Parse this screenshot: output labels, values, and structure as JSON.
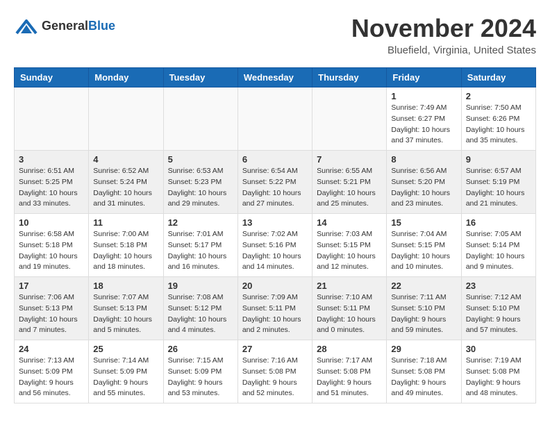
{
  "header": {
    "logo_general": "General",
    "logo_blue": "Blue",
    "month_title": "November 2024",
    "location": "Bluefield, Virginia, United States"
  },
  "weekdays": [
    "Sunday",
    "Monday",
    "Tuesday",
    "Wednesday",
    "Thursday",
    "Friday",
    "Saturday"
  ],
  "weeks": [
    [
      {
        "day": "",
        "info": ""
      },
      {
        "day": "",
        "info": ""
      },
      {
        "day": "",
        "info": ""
      },
      {
        "day": "",
        "info": ""
      },
      {
        "day": "",
        "info": ""
      },
      {
        "day": "1",
        "info": "Sunrise: 7:49 AM\nSunset: 6:27 PM\nDaylight: 10 hours\nand 37 minutes."
      },
      {
        "day": "2",
        "info": "Sunrise: 7:50 AM\nSunset: 6:26 PM\nDaylight: 10 hours\nand 35 minutes."
      }
    ],
    [
      {
        "day": "3",
        "info": "Sunrise: 6:51 AM\nSunset: 5:25 PM\nDaylight: 10 hours\nand 33 minutes."
      },
      {
        "day": "4",
        "info": "Sunrise: 6:52 AM\nSunset: 5:24 PM\nDaylight: 10 hours\nand 31 minutes."
      },
      {
        "day": "5",
        "info": "Sunrise: 6:53 AM\nSunset: 5:23 PM\nDaylight: 10 hours\nand 29 minutes."
      },
      {
        "day": "6",
        "info": "Sunrise: 6:54 AM\nSunset: 5:22 PM\nDaylight: 10 hours\nand 27 minutes."
      },
      {
        "day": "7",
        "info": "Sunrise: 6:55 AM\nSunset: 5:21 PM\nDaylight: 10 hours\nand 25 minutes."
      },
      {
        "day": "8",
        "info": "Sunrise: 6:56 AM\nSunset: 5:20 PM\nDaylight: 10 hours\nand 23 minutes."
      },
      {
        "day": "9",
        "info": "Sunrise: 6:57 AM\nSunset: 5:19 PM\nDaylight: 10 hours\nand 21 minutes."
      }
    ],
    [
      {
        "day": "10",
        "info": "Sunrise: 6:58 AM\nSunset: 5:18 PM\nDaylight: 10 hours\nand 19 minutes."
      },
      {
        "day": "11",
        "info": "Sunrise: 7:00 AM\nSunset: 5:18 PM\nDaylight: 10 hours\nand 18 minutes."
      },
      {
        "day": "12",
        "info": "Sunrise: 7:01 AM\nSunset: 5:17 PM\nDaylight: 10 hours\nand 16 minutes."
      },
      {
        "day": "13",
        "info": "Sunrise: 7:02 AM\nSunset: 5:16 PM\nDaylight: 10 hours\nand 14 minutes."
      },
      {
        "day": "14",
        "info": "Sunrise: 7:03 AM\nSunset: 5:15 PM\nDaylight: 10 hours\nand 12 minutes."
      },
      {
        "day": "15",
        "info": "Sunrise: 7:04 AM\nSunset: 5:15 PM\nDaylight: 10 hours\nand 10 minutes."
      },
      {
        "day": "16",
        "info": "Sunrise: 7:05 AM\nSunset: 5:14 PM\nDaylight: 10 hours\nand 9 minutes."
      }
    ],
    [
      {
        "day": "17",
        "info": "Sunrise: 7:06 AM\nSunset: 5:13 PM\nDaylight: 10 hours\nand 7 minutes."
      },
      {
        "day": "18",
        "info": "Sunrise: 7:07 AM\nSunset: 5:13 PM\nDaylight: 10 hours\nand 5 minutes."
      },
      {
        "day": "19",
        "info": "Sunrise: 7:08 AM\nSunset: 5:12 PM\nDaylight: 10 hours\nand 4 minutes."
      },
      {
        "day": "20",
        "info": "Sunrise: 7:09 AM\nSunset: 5:11 PM\nDaylight: 10 hours\nand 2 minutes."
      },
      {
        "day": "21",
        "info": "Sunrise: 7:10 AM\nSunset: 5:11 PM\nDaylight: 10 hours\nand 0 minutes."
      },
      {
        "day": "22",
        "info": "Sunrise: 7:11 AM\nSunset: 5:10 PM\nDaylight: 9 hours\nand 59 minutes."
      },
      {
        "day": "23",
        "info": "Sunrise: 7:12 AM\nSunset: 5:10 PM\nDaylight: 9 hours\nand 57 minutes."
      }
    ],
    [
      {
        "day": "24",
        "info": "Sunrise: 7:13 AM\nSunset: 5:09 PM\nDaylight: 9 hours\nand 56 minutes."
      },
      {
        "day": "25",
        "info": "Sunrise: 7:14 AM\nSunset: 5:09 PM\nDaylight: 9 hours\nand 55 minutes."
      },
      {
        "day": "26",
        "info": "Sunrise: 7:15 AM\nSunset: 5:09 PM\nDaylight: 9 hours\nand 53 minutes."
      },
      {
        "day": "27",
        "info": "Sunrise: 7:16 AM\nSunset: 5:08 PM\nDaylight: 9 hours\nand 52 minutes."
      },
      {
        "day": "28",
        "info": "Sunrise: 7:17 AM\nSunset: 5:08 PM\nDaylight: 9 hours\nand 51 minutes."
      },
      {
        "day": "29",
        "info": "Sunrise: 7:18 AM\nSunset: 5:08 PM\nDaylight: 9 hours\nand 49 minutes."
      },
      {
        "day": "30",
        "info": "Sunrise: 7:19 AM\nSunset: 5:08 PM\nDaylight: 9 hours\nand 48 minutes."
      }
    ]
  ]
}
